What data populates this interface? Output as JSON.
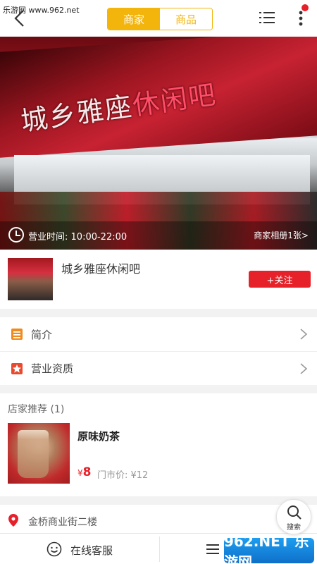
{
  "watermark": "乐游网 www.962.net",
  "header": {
    "tabs": [
      {
        "label": "商家",
        "active": true
      },
      {
        "label": "商品",
        "active": false
      }
    ],
    "accent_color": "#f3b50b",
    "notification_color": "#e6212a"
  },
  "hero": {
    "sign_text_main": "城乡雅座",
    "sign_text_accent": "休闲吧",
    "hours_label": "营业时间:",
    "hours_value": "10:00-22:00",
    "album_label": "商家相册1张>"
  },
  "store": {
    "name": "城乡雅座休闲吧",
    "follow_label": "+关注"
  },
  "menu": [
    {
      "label": "简介",
      "icon": "intro-icon"
    },
    {
      "label": "营业资质",
      "icon": "license-icon"
    }
  ],
  "recommend": {
    "title": "店家推荐 (1)",
    "items": [
      {
        "name": "原味奶茶",
        "currency": "¥",
        "price": "8",
        "original_price": "门市价: ¥12"
      }
    ]
  },
  "address": "金桥商业街二楼",
  "bottom_bar": {
    "service_label": "在线客服",
    "logo_text": "962.NET 乐游网"
  },
  "search_fab": {
    "label": "搜索"
  },
  "brand_red": "#e6212a"
}
